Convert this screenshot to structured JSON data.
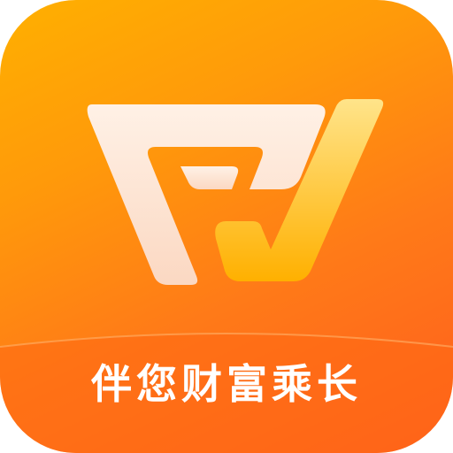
{
  "icon": {
    "slogan": "伴您财富乘长",
    "logo_name": "rv-monogram-logo",
    "colors": {
      "gradient_top": "#ffb000",
      "gradient_bottom": "#ff5d1e",
      "logo_light": "#fde8d8",
      "logo_gold_top": "#ffe17a",
      "logo_gold_bottom": "#ffb400",
      "text": "#ffffff"
    }
  }
}
